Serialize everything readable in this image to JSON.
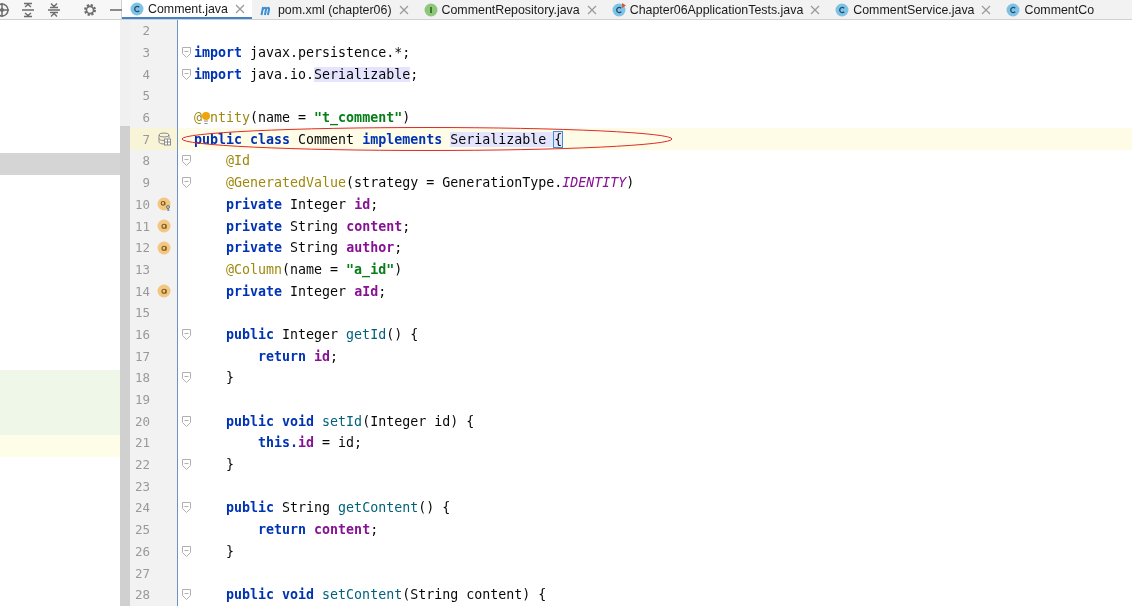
{
  "toolbar": {
    "buttons": [
      {
        "kind": "locate"
      },
      {
        "kind": "expand"
      },
      {
        "kind": "collapse"
      },
      {
        "kind": "settings"
      },
      {
        "kind": "hide"
      }
    ]
  },
  "tabs": [
    {
      "label": "Comment.java",
      "kind": "class",
      "selected": true,
      "closable": true
    },
    {
      "label": "pom.xml (chapter06)",
      "kind": "maven",
      "selected": false,
      "closable": true
    },
    {
      "label": "CommentRepository.java",
      "kind": "interface",
      "selected": false,
      "closable": true
    },
    {
      "label": "Chapter06ApplicationTests.java",
      "kind": "test",
      "selected": false,
      "closable": true
    },
    {
      "label": "CommentService.java",
      "kind": "class",
      "selected": false,
      "closable": true
    },
    {
      "label": "CommentCo",
      "kind": "class",
      "selected": false
    }
  ],
  "editor": {
    "lines": [
      {
        "number": "2"
      },
      {
        "number": "3",
        "fold": true,
        "segments": [
          {
            "text": "import ",
            "kind": "kw"
          },
          {
            "text": "javax.persistence.*;",
            "kind": "plain"
          }
        ]
      },
      {
        "number": "4",
        "fold": true,
        "segments": [
          {
            "text": "import ",
            "kind": "kw"
          },
          {
            "text": "java.io.",
            "kind": "plain"
          },
          {
            "text": "Serializable",
            "kind": "usage"
          },
          {
            "text": ";",
            "kind": "plain"
          }
        ]
      },
      {
        "number": "5"
      },
      {
        "number": "6",
        "segments": [
          {
            "text": "@",
            "kind": "ann"
          },
          {
            "kind": "bulb"
          },
          {
            "text": "ntity",
            "kind": "ann"
          },
          {
            "text": "(name = ",
            "kind": "plain"
          },
          {
            "text": "\"t_comment\"",
            "kind": "str"
          },
          {
            "text": ")",
            "kind": "plain"
          }
        ]
      },
      {
        "number": "7",
        "gutter_icon": {
          "kind": "table"
        },
        "current": true,
        "circled": true,
        "segments": [
          {
            "text": "public class ",
            "kind": "kw"
          },
          {
            "text": "Comment ",
            "kind": "plain"
          },
          {
            "text": "implements ",
            "kind": "kw"
          },
          {
            "text": "Serializable ",
            "kind": "usage"
          },
          {
            "text": "{",
            "kind": "brace"
          }
        ]
      },
      {
        "number": "8",
        "fold": true,
        "left_band": {
          "kind": "selected"
        },
        "segments": [
          {
            "text": "    @Id",
            "kind": "ann"
          }
        ]
      },
      {
        "number": "9",
        "fold": true,
        "segments": [
          {
            "text": "    @GeneratedValue",
            "kind": "ann"
          },
          {
            "text": "(strategy = GenerationType.",
            "kind": "plain"
          },
          {
            "text": "IDENTITY",
            "kind": "const"
          },
          {
            "text": ")",
            "kind": "plain"
          }
        ]
      },
      {
        "number": "10",
        "gutter_icon": {
          "kind": "field_key"
        },
        "segments": [
          {
            "text": "    private ",
            "kind": "kw"
          },
          {
            "text": "Integer ",
            "kind": "plain"
          },
          {
            "text": "id",
            "kind": "field"
          },
          {
            "text": ";",
            "kind": "plain"
          }
        ]
      },
      {
        "number": "11",
        "gutter_icon": {
          "kind": "field"
        },
        "segments": [
          {
            "text": "    private ",
            "kind": "kw"
          },
          {
            "text": "String ",
            "kind": "plain"
          },
          {
            "text": "content",
            "kind": "field"
          },
          {
            "text": ";",
            "kind": "plain"
          }
        ]
      },
      {
        "number": "12",
        "gutter_icon": {
          "kind": "field"
        },
        "segments": [
          {
            "text": "    private ",
            "kind": "kw"
          },
          {
            "text": "String ",
            "kind": "plain"
          },
          {
            "text": "author",
            "kind": "field"
          },
          {
            "text": ";",
            "kind": "plain"
          }
        ]
      },
      {
        "number": "13",
        "segments": [
          {
            "text": "    @Column",
            "kind": "ann"
          },
          {
            "text": "(name = ",
            "kind": "plain"
          },
          {
            "text": "\"a_id\"",
            "kind": "str"
          },
          {
            "text": ")",
            "kind": "plain"
          }
        ]
      },
      {
        "number": "14",
        "gutter_icon": {
          "kind": "field"
        },
        "segments": [
          {
            "text": "    private ",
            "kind": "kw"
          },
          {
            "text": "Integer ",
            "kind": "plain"
          },
          {
            "text": "aId",
            "kind": "field"
          },
          {
            "text": ";",
            "kind": "plain"
          }
        ]
      },
      {
        "number": "15"
      },
      {
        "number": "16",
        "fold": true,
        "segments": [
          {
            "text": "    public ",
            "kind": "kw"
          },
          {
            "text": "Integer ",
            "kind": "plain"
          },
          {
            "text": "getId",
            "kind": "method"
          },
          {
            "text": "() {",
            "kind": "plain"
          }
        ]
      },
      {
        "number": "17",
        "segments": [
          {
            "text": "        return ",
            "kind": "kw"
          },
          {
            "text": "id",
            "kind": "field"
          },
          {
            "text": ";",
            "kind": "plain"
          }
        ]
      },
      {
        "number": "18",
        "fold": true,
        "left_band": {
          "kind": "added"
        },
        "segments": [
          {
            "text": "    }",
            "kind": "plain"
          }
        ]
      },
      {
        "number": "19",
        "left_band": {
          "kind": "added"
        }
      },
      {
        "number": "20",
        "fold": true,
        "left_band": {
          "kind": "added"
        },
        "segments": [
          {
            "text": "    public void ",
            "kind": "kw"
          },
          {
            "text": "setId",
            "kind": "method"
          },
          {
            "text": "(Integer id) {",
            "kind": "plain"
          }
        ]
      },
      {
        "number": "21",
        "left_band": {
          "kind": "current"
        },
        "segments": [
          {
            "text": "        this.",
            "kind": "kw"
          },
          {
            "text": "id",
            "kind": "field"
          },
          {
            "text": " = id;",
            "kind": "plain"
          }
        ]
      },
      {
        "number": "22",
        "fold": true,
        "segments": [
          {
            "text": "    }",
            "kind": "plain"
          }
        ]
      },
      {
        "number": "23"
      },
      {
        "number": "24",
        "fold": true,
        "segments": [
          {
            "text": "    public ",
            "kind": "kw"
          },
          {
            "text": "String ",
            "kind": "plain"
          },
          {
            "text": "getContent",
            "kind": "method"
          },
          {
            "text": "() {",
            "kind": "plain"
          }
        ]
      },
      {
        "number": "25",
        "segments": [
          {
            "text": "        return ",
            "kind": "kw"
          },
          {
            "text": "content",
            "kind": "field"
          },
          {
            "text": ";",
            "kind": "plain"
          }
        ]
      },
      {
        "number": "26",
        "fold": true,
        "segments": [
          {
            "text": "    }",
            "kind": "plain"
          }
        ]
      },
      {
        "number": "27"
      },
      {
        "number": "28",
        "fold": true,
        "segments": [
          {
            "text": "    public void ",
            "kind": "kw"
          },
          {
            "text": "setContent",
            "kind": "method"
          },
          {
            "text": "(String content) {",
            "kind": "plain"
          }
        ]
      }
    ]
  }
}
